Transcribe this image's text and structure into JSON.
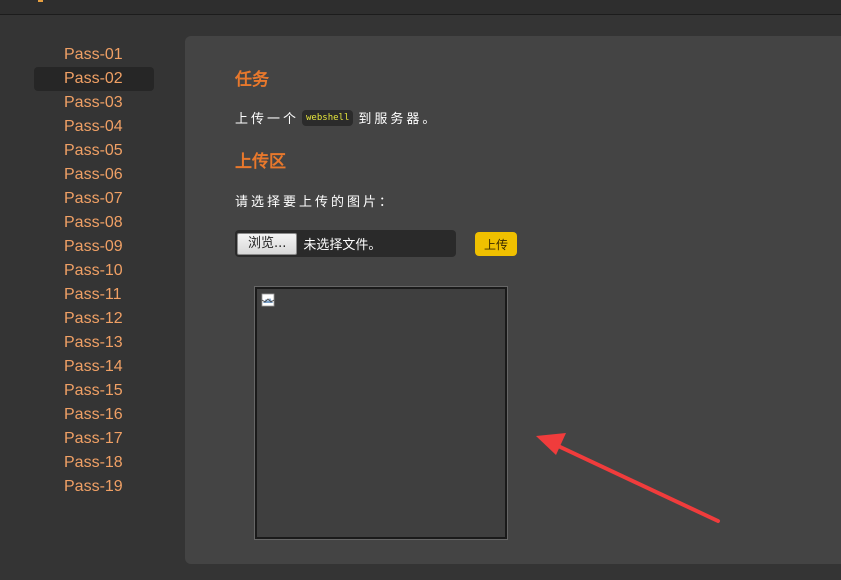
{
  "sidebar": {
    "items": [
      {
        "label": "Pass-01"
      },
      {
        "label": "Pass-02"
      },
      {
        "label": "Pass-03"
      },
      {
        "label": "Pass-04"
      },
      {
        "label": "Pass-05"
      },
      {
        "label": "Pass-06"
      },
      {
        "label": "Pass-07"
      },
      {
        "label": "Pass-08"
      },
      {
        "label": "Pass-09"
      },
      {
        "label": "Pass-10"
      },
      {
        "label": "Pass-11"
      },
      {
        "label": "Pass-12"
      },
      {
        "label": "Pass-13"
      },
      {
        "label": "Pass-14"
      },
      {
        "label": "Pass-15"
      },
      {
        "label": "Pass-16"
      },
      {
        "label": "Pass-17"
      },
      {
        "label": "Pass-18"
      },
      {
        "label": "Pass-19"
      }
    ],
    "active_index": 1
  },
  "task": {
    "title": "任务",
    "text_before": "上传一个",
    "code": "webshell",
    "text_after": "到服务器。"
  },
  "upload": {
    "title": "上传区",
    "prompt": "请选择要上传的图片：",
    "browse_label": "浏览...",
    "file_status": "未选择文件。",
    "submit_label": "上传"
  },
  "colors": {
    "accent": "#e8782c",
    "link": "#f0a065",
    "button": "#f0c000",
    "annotation": "#f03c3c"
  }
}
